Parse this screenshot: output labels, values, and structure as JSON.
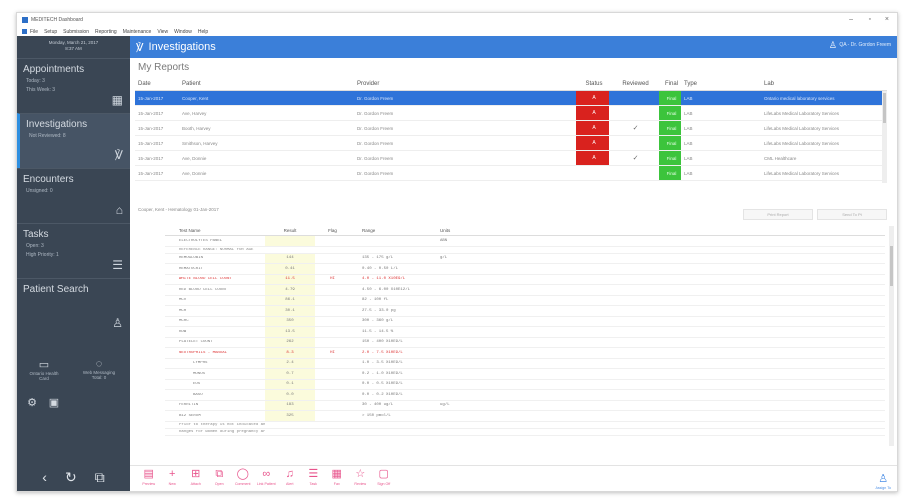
{
  "window": {
    "title": "MEDITECH Dashboard",
    "menu": [
      "File",
      "Setup",
      "Submission",
      "Reporting",
      "Maintenance",
      "View",
      "Window",
      "Help"
    ]
  },
  "sidebar": {
    "date": "Monday, March 21, 2017",
    "time": "8:37 AM",
    "sections": [
      {
        "title": "Appointments",
        "subs": [
          "Today: 3",
          "This Week: 3"
        ],
        "icon": "calendar-icon"
      },
      {
        "title": "Investigations",
        "subs": [
          "Not Reviewed: 8"
        ],
        "icon": "stethoscope-icon"
      },
      {
        "title": "Encounters",
        "subs": [
          "Unsigned: 0"
        ],
        "icon": "hospital-icon"
      },
      {
        "title": "Tasks",
        "subs": [
          "Open: 3",
          "High Priority: 1"
        ],
        "icon": "task-list-icon"
      },
      {
        "title": "Patient Search",
        "subs": [],
        "icon": "people-icon"
      }
    ],
    "features": [
      {
        "label": "Ontario Health Card",
        "icon": "card-icon"
      },
      {
        "label": "Web Messaging Total: 0",
        "icon": "chat-icon"
      }
    ],
    "bottom_icons": [
      "back-icon",
      "refresh-icon",
      "external-link-icon"
    ]
  },
  "header": {
    "title": "Investigations",
    "user": "QA - Dr. Gordon Freem"
  },
  "reports": {
    "title": "My Reports",
    "columns": [
      "Date",
      "Patient",
      "Provider",
      "Status",
      "Reviewed",
      "Final",
      "Type",
      "Lab"
    ],
    "rows": [
      {
        "date": "15-Jan-2017",
        "patient": "Cooper, Kent",
        "provider": "Dr. Gordon Freem",
        "status": "A",
        "reviewed": "",
        "final": "Final",
        "type": "LAB",
        "lab": "Ontario medical laboratory services",
        "selected": true
      },
      {
        "date": "15-Jan-2017",
        "patient": "Ave, Harvey",
        "provider": "Dr. Gordon Freem",
        "status": "A",
        "reviewed": "",
        "final": "Final",
        "type": "LAB",
        "lab": "LifeLabs Medical Laboratory Services",
        "selected": false
      },
      {
        "date": "15-Jan-2017",
        "patient": "Booth, Harvey",
        "provider": "Dr. Gordon Freem",
        "status": "A",
        "reviewed": "✓",
        "final": "Final",
        "type": "LAB",
        "lab": "LifeLabs Medical Laboratory Services",
        "selected": false
      },
      {
        "date": "15-Jan-2017",
        "patient": "Smithson, Harvey",
        "provider": "Dr. Gordon Freem",
        "status": "A",
        "reviewed": "",
        "final": "Final",
        "type": "LAB",
        "lab": "LifeLabs Medical Laboratory Services",
        "selected": false
      },
      {
        "date": "15-Jan-2017",
        "patient": "Ave, Donnie",
        "provider": "Dr. Gordon Freem",
        "status": "A",
        "reviewed": "✓",
        "final": "Final",
        "type": "LAB",
        "lab": "CML Healthcare",
        "selected": false
      },
      {
        "date": "15-Jan-2017",
        "patient": "Ave, Donnie",
        "provider": "Dr. Gordon Freem",
        "status": "",
        "reviewed": "",
        "final": "Final",
        "type": "LAB",
        "lab": "LifeLabs Medical Laboratory Services",
        "selected": false
      }
    ]
  },
  "detail": {
    "title": "Cooper, Kent - Hematology 01-Jan-2017",
    "buttons": [
      "Print Report",
      "Send To Pt"
    ],
    "columns": [
      "Test Name",
      "Result",
      "Flag",
      "Range",
      "Units"
    ],
    "rows": [
      {
        "name": "ELECTROLYTES PANEL",
        "result": "",
        "flag": "",
        "range": "",
        "units": "",
        "cls": "",
        "head": "ABN"
      },
      {
        "name": "    REFERENCE RANGE: NORMAL FOR AGE",
        "result": "",
        "flag": "",
        "range": "",
        "units": "",
        "cls": "note"
      },
      {
        "name": "HEMOGLOBIN",
        "result": "144",
        "flag": "",
        "range": "135 - 175 g/L",
        "units": "g/L",
        "cls": ""
      },
      {
        "name": "HEMATOCRIT",
        "result": "0.41",
        "flag": "",
        "range": "0.40 - 0.50 L/L",
        "units": "",
        "cls": ""
      },
      {
        "name": "WHITE BLOOD CELL COUNT",
        "result": "11.5",
        "flag": "HI",
        "range": "4.0 - 11.0 X10E9/L",
        "units": "",
        "cls": "ab"
      },
      {
        "name": "RED BLOOD CELL COUNT",
        "result": "4.79",
        "flag": "",
        "range": "4.50 - 6.00 X10E12/L",
        "units": "",
        "cls": ""
      },
      {
        "name": "MCV",
        "result": "86.1",
        "flag": "",
        "range": "82 - 100 fL",
        "units": "",
        "cls": ""
      },
      {
        "name": "MCH",
        "result": "30.1",
        "flag": "",
        "range": "27.5 - 33.0 pg",
        "units": "",
        "cls": ""
      },
      {
        "name": "MCHC",
        "result": "350",
        "flag": "",
        "range": "300 - 360 g/L",
        "units": "",
        "cls": ""
      },
      {
        "name": "RDW",
        "result": "13.5",
        "flag": "",
        "range": "11.5 - 14.5 %",
        "units": "",
        "cls": ""
      },
      {
        "name": "PLATELET COUNT",
        "result": "262",
        "flag": "",
        "range": "150 - 400 X10E9/L",
        "units": "",
        "cls": ""
      },
      {
        "name": "NEUTROPHILS - MANUAL",
        "result": "8.3",
        "flag": "HI",
        "range": "2.0 - 7.5 X10E9/L",
        "units": "",
        "cls": "ab"
      },
      {
        "name": "LYMPHS",
        "result": "2.4",
        "flag": "",
        "range": "1.0 - 3.5 X10E9/L",
        "units": "",
        "cls": "ind"
      },
      {
        "name": "MONOS",
        "result": "0.7",
        "flag": "",
        "range": "0.2 - 1.0 X10E9/L",
        "units": "",
        "cls": "ind"
      },
      {
        "name": "EOS",
        "result": "0.1",
        "flag": "",
        "range": "0.0 - 0.5 X10E9/L",
        "units": "",
        "cls": "ind"
      },
      {
        "name": "BASO",
        "result": "0.0",
        "flag": "",
        "range": "0.0 - 0.2 X10E9/L",
        "units": "",
        "cls": "ind"
      },
      {
        "name": "FERRITIN",
        "result": "183",
        "flag": "",
        "range": "30 - 400 ug/L",
        "units": "ug/L",
        "cls": ""
      },
      {
        "name": "B12 SERUM",
        "result": "325",
        "flag": "",
        "range": "> 150 pmol/L",
        "units": "",
        "cls": ""
      },
      {
        "name": "    Prior to therapy is not indicated and this result",
        "result": "",
        "flag": "",
        "range": "",
        "units": "",
        "cls": "note"
      },
      {
        "name": "    Ranges for women during pregnancy are lower",
        "result": "",
        "flag": "",
        "range": "",
        "units": "",
        "cls": "note"
      }
    ]
  },
  "toolbar": {
    "buttons": [
      {
        "label": "Preview",
        "icon": "preview-icon",
        "glyph": "▤"
      },
      {
        "label": "New",
        "icon": "plus-icon",
        "glyph": "+"
      },
      {
        "label": "Attach",
        "icon": "attach-icon",
        "glyph": "⊞"
      },
      {
        "label": "Open",
        "icon": "open-icon",
        "glyph": "⧉"
      },
      {
        "label": "Comment",
        "icon": "comment-icon",
        "glyph": "◯"
      },
      {
        "label": "Link Patient",
        "icon": "link-icon",
        "glyph": "∞"
      },
      {
        "label": "Alert",
        "icon": "bell-icon",
        "glyph": "♫"
      },
      {
        "label": "Task",
        "icon": "task-icon",
        "glyph": "☰"
      },
      {
        "label": "Fax",
        "icon": "fax-icon",
        "glyph": "▦"
      },
      {
        "label": "Review",
        "icon": "star-icon",
        "glyph": "☆"
      },
      {
        "label": "Sign Off",
        "icon": "sign-off-icon",
        "glyph": "▢"
      }
    ],
    "right": {
      "label": "Assign To",
      "icon": "person-icon",
      "glyph": "♙"
    }
  },
  "colors": {
    "sidebar_bg": "#3a4654",
    "header_bg": "#3b7fd9",
    "selected_row": "#2e73d9",
    "status_red": "#d9221e",
    "final_green": "#3cc43c",
    "toolbar_pink": "#e8548c"
  }
}
